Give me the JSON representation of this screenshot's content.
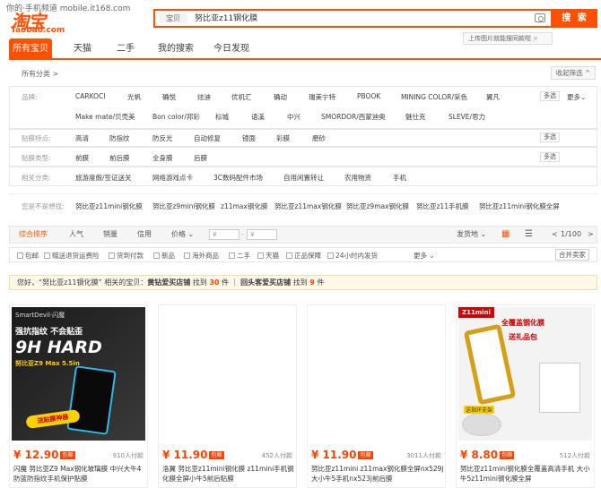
{
  "watermark": "你的·手机频道 mobile.it168.com",
  "logo": {
    "top": "淘宝",
    "url": "Taobao.com"
  },
  "search": {
    "tag": "宝贝",
    "value": "努比亚z11钢化膜",
    "button": "搜 索",
    "upload_tip": "上传图片就能搜同款啦"
  },
  "tabs": [
    "所有宝贝",
    "天猫",
    "二手",
    "我的搜索",
    "今日发现"
  ],
  "allcat": "所有分类 >",
  "fold": "收起筛选 ^",
  "props": {
    "brand_label": "品牌:",
    "brand_items": [
      "CARKOCI",
      "光帆",
      "确悦",
      "炫迪",
      "优机汇",
      "确动",
      "瑞美宁特",
      "PBOOK",
      "MINING COLOR/采色",
      "翼凡",
      "Make mate/贝壳美",
      "Bon color/邦彩",
      "标城",
      "语溪",
      "中兴",
      "SMORDOR/西蒙迪奥",
      "魅仕克",
      "SLEVE/思力"
    ],
    "feature_label": "贴膜特点:",
    "feature_items": [
      "高清",
      "防指纹",
      "防反光",
      "自动修复",
      "镜面",
      "彩膜",
      "磨砂"
    ],
    "type_label": "贴膜类型:",
    "type_items": [
      "前膜",
      "前后膜",
      "全身膜",
      "后膜"
    ],
    "cat_label": "相关分类:",
    "cat_items": [
      "旅游度假/签证送关",
      "网络游戏点卡",
      "3C数码配件市场",
      "自用闲置转让",
      "农用物资",
      "手机"
    ],
    "multi": "多选",
    "more": "更多"
  },
  "related": {
    "label": "您是不是想找:",
    "items": [
      "努比亚z11mini钢化膜",
      "努比亚z9mini钢化膜",
      "z11max钢化膜",
      "努比亚z11max钢化膜",
      "努比亚z9max钢化膜",
      "努比亚z11手机膜",
      "努比亚z11mini钢化膜全屏"
    ]
  },
  "sort": {
    "items": [
      "综合排序",
      "人气",
      "销量",
      "信用",
      "价格"
    ],
    "price_from": "¥",
    "price_to": "¥",
    "ship": "发货地",
    "page": "1/100"
  },
  "filters": [
    "包邮",
    "赠送退货运费险",
    "货到付款",
    "新品",
    "海外商品",
    "二手",
    "天猫",
    "正品保障",
    "24小时内发货",
    "更多",
    "合并卖家"
  ],
  "notice": {
    "pre": "您好，“努比亚z11钢化膜” 相关的宝贝：",
    "a": "黄钻爱买店铺",
    "b": "找到",
    "c": "30",
    "d": "件",
    "e": "回头客爱买店铺",
    "f": "找到",
    "g": "9",
    "h": "件"
  },
  "products": [
    {
      "price": "¥ 12.90",
      "baoyou": "包邮",
      "paid": "910人付款",
      "title": "闪魔 努比亚Z9 Max钢化玻璃膜 中兴大牛4 防蓝防指纹手机保护贴膜",
      "img_text": [
        "SmartDevil·闪魔",
        "强抗指纹 不会贴歪",
        "9H HARD",
        "努比亚Z9 Max 5.5in",
        "送贴膜神器"
      ]
    },
    {
      "price": "¥ 11.90",
      "baoyou": "包邮",
      "paid": "452人付款",
      "title": "洛翼 努比亚z11mini钢化膜 z11mini手机钢化膜全屏小牛5前后贴膜"
    },
    {
      "price": "¥ 11.90",
      "baoyou": "包邮",
      "paid": "3011人付款",
      "title": "努比亚z11mini z11max钢化膜全屏nx529j 大小牛5手机nx523j前后膜"
    },
    {
      "price": "¥ 8.80",
      "baoyou": "包邮",
      "paid": "512人付款",
      "title": "努比亚z11mini钢化膜全覆盖高清手机 大小牛5z11mini钢化膜全屏",
      "img_text": [
        "Z11mini",
        "全覆盖钢化膜",
        "送礼品包",
        "送指环支架"
      ]
    }
  ],
  "colors": {
    "accent": "#ff5000",
    "price": "#ff4400"
  }
}
